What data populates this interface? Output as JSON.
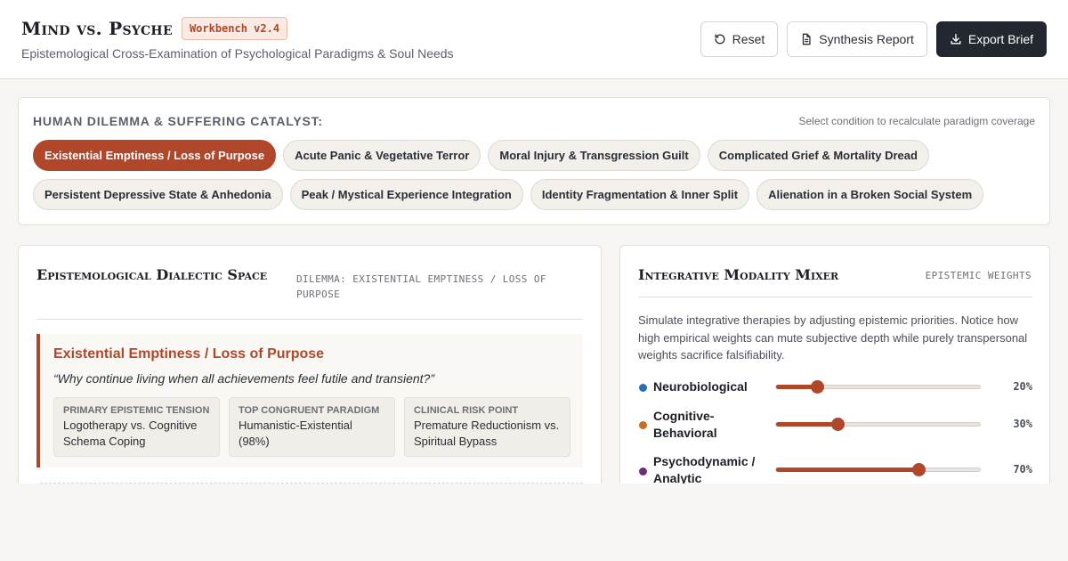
{
  "header": {
    "title": "Mind vs. Psyche",
    "version": "Workbench v2.4",
    "subtitle": "Epistemological Cross-Examination of Psychological Paradigms & Soul Needs",
    "actions": {
      "reset": "Reset",
      "report": "Synthesis Report",
      "export": "Export Brief"
    }
  },
  "catalyst": {
    "label": "HUMAN DILEMMA & SUFFERING CATALYST:",
    "hint": "Select condition to recalculate paradigm coverage",
    "active_index": 0,
    "chips": [
      "Existential Emptiness / Loss of Purpose",
      "Acute Panic & Vegetative Terror",
      "Moral Injury & Transgression Guilt",
      "Complicated Grief & Mortality Dread",
      "Persistent Depressive State & Anhedonia",
      "Peak / Mystical Experience Integration",
      "Identity Fragmentation & Inner Split",
      "Alienation in a Broken Social System"
    ]
  },
  "dialectic": {
    "title": "Epistemological Dialectic Space",
    "meta": "DILEMMA: EXISTENTIAL EMPTINESS / LOSS OF PURPOSE",
    "name": "Existential Emptiness / Loss of Purpose",
    "quote": "“Why continue living when all achievements feel futile and transient?”",
    "facts": [
      {
        "label": "Primary Epistemic Tension",
        "value": "Logotherapy vs. Cognitive Schema Coping"
      },
      {
        "label": "Top Congruent Paradigm",
        "value": "Humanistic-Existential (98%)"
      },
      {
        "label": "Clinical Risk Point",
        "value": "Premature Reductionism vs. Spiritual Bypass"
      }
    ]
  },
  "mixer": {
    "title": "Integrative Modality Mixer",
    "meta": "EPISTEMIC WEIGHTS",
    "description": "Simulate integrative therapies by adjusting epistemic priorities. Notice how high empirical weights can mute subjective depth while purely transpersonal weights sacrifice falsifiability.",
    "rows": [
      {
        "label": "Neurobiological",
        "value": 20,
        "value_label": "20%",
        "color": "#2c6fb7"
      },
      {
        "label": "Cognitive-Behavioral",
        "value": 30,
        "value_label": "30%",
        "color": "#c4701e"
      },
      {
        "label": "Psychodynamic / Analytic",
        "value": 70,
        "value_label": "70%",
        "color": "#6b2f7a"
      }
    ]
  }
}
